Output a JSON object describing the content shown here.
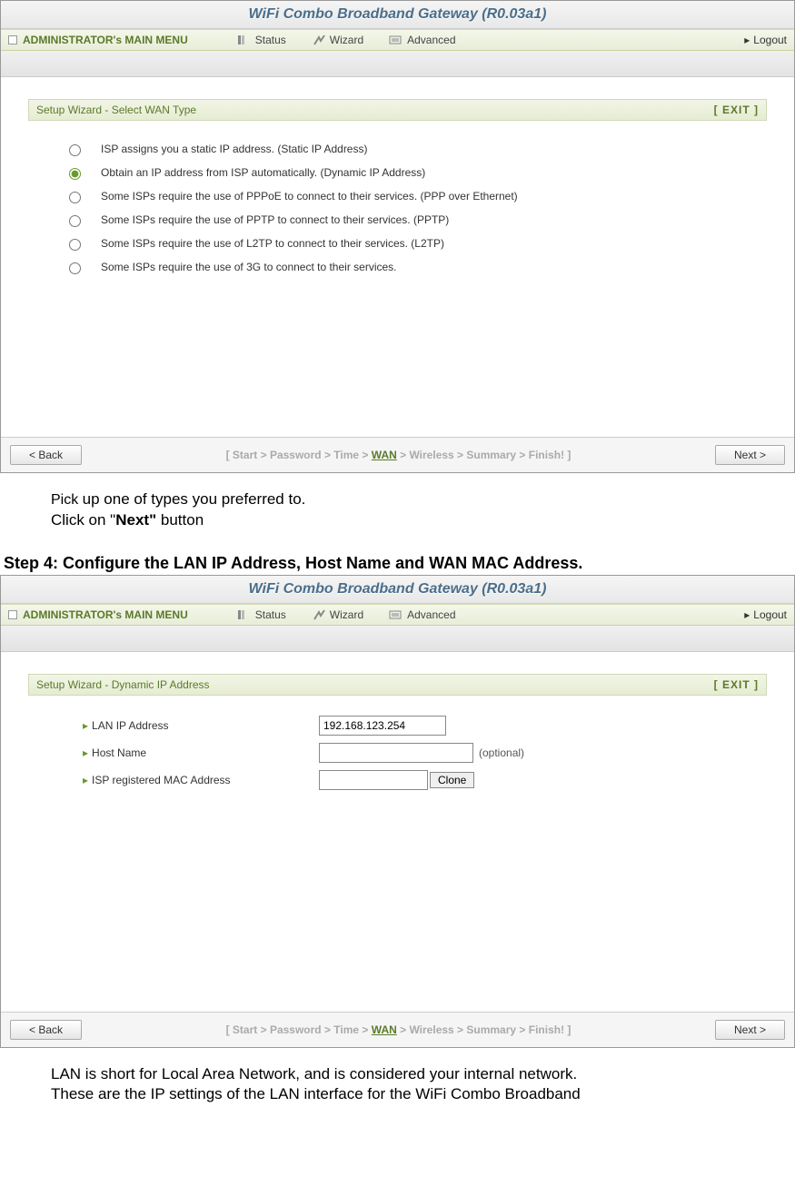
{
  "router_title": "WiFi Combo Broadband Gateway (R0.03a1)",
  "menu": {
    "admin": "ADMINISTRATOR's MAIN MENU",
    "status": "Status",
    "wizard": "Wizard",
    "advanced": "Advanced",
    "logout": "Logout"
  },
  "panel1": {
    "header": "Setup Wizard - Select WAN Type",
    "exit": "[ EXIT ]",
    "options": [
      "ISP assigns you a static IP address. (Static IP Address)",
      "Obtain an IP address from ISP automatically. (Dynamic IP Address)",
      "Some ISPs require the use of PPPoE to connect to their services. (PPP over Ethernet)",
      "Some ISPs require the use of PPTP to connect to their services. (PPTP)",
      "Some ISPs require the use of L2TP to connect to their services. (L2TP)",
      "Some ISPs require the use of 3G to connect to their services."
    ],
    "selected_index": 1,
    "back": "< Back",
    "next": "Next >",
    "crumb_prefix": "[ Start > Password > Time > ",
    "crumb_active": "WAN",
    "crumb_suffix": " > Wireless > Summary > Finish! ]"
  },
  "instructions1": {
    "line1a": "Pick ",
    "line1b": "up one of types you preferred to.",
    "line2a": "Click on \"",
    "line2b": "Next\"",
    "line2c": " button"
  },
  "step4_heading": "Step 4: Configure the LAN IP Address, Host Name and WAN MAC Address.",
  "panel2": {
    "header": "Setup Wizard - Dynamic IP Address",
    "exit": "[ EXIT ]",
    "fields": {
      "lan_label": "LAN IP Address",
      "lan_value": "192.168.123.254",
      "host_label": "Host Name",
      "host_value": "",
      "host_optional": "(optional)",
      "mac_label": "ISP registered MAC Address",
      "mac_value": "",
      "clone": "Clone"
    },
    "back": "< Back",
    "next": "Next >",
    "crumb_prefix": "[ Start > Password > Time > ",
    "crumb_active": "WAN",
    "crumb_suffix": " > Wireless > Summary > Finish! ]"
  },
  "instructions2": {
    "line1": "LAN is short for Local Area Network, and is considered your internal network.",
    "line2": "These are the IP settings of the LAN interface for the WiFi Combo Broadband"
  }
}
